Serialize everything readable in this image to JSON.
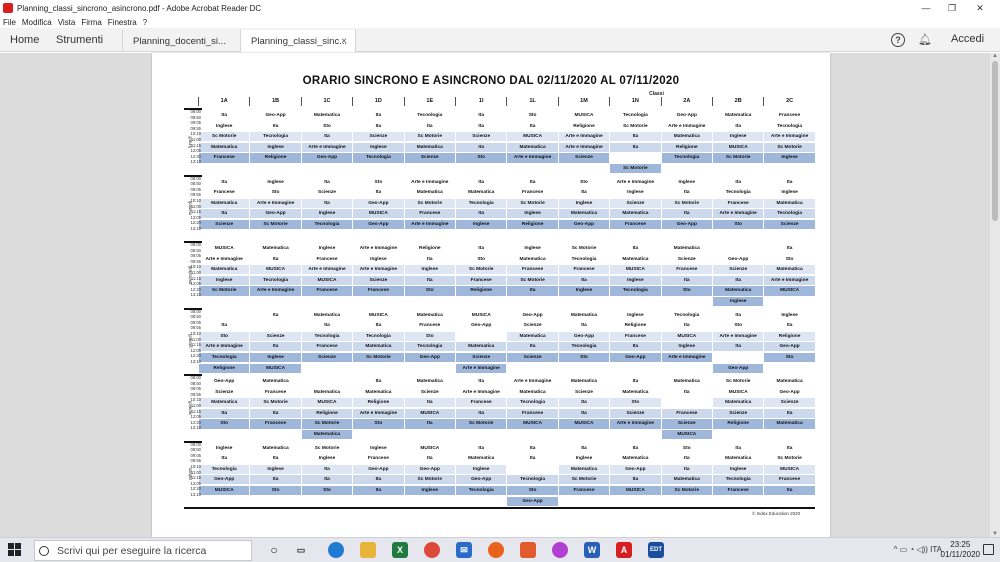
{
  "window": {
    "title": "Planning_classi_sincrono_asincrono.pdf - Adobe Acrobat Reader DC",
    "min": "—",
    "max": "❐",
    "close": "✕"
  },
  "menu": [
    "File",
    "Modifica",
    "Vista",
    "Firma",
    "Finestra",
    "?"
  ],
  "tabs": {
    "home": "Home",
    "tools": "Strumenti",
    "docs": [
      {
        "label": "Planning_docenti_si..."
      },
      {
        "label": "Planning_classi_sinc...",
        "close": "×"
      }
    ],
    "help": "?",
    "signin": "Accedi"
  },
  "doc": {
    "title": "ORARIO SINCRONO E ASINCRONO DAL 02/11/2020 AL 07/11/2020",
    "group_label": "Classi",
    "footer": "© Index Education 2020",
    "classes": [
      "1A",
      "1B",
      "1C",
      "1D",
      "1E",
      "1I",
      "1L",
      "1M",
      "1N",
      "2A",
      "2B",
      "2C"
    ],
    "colors": {
      "c0": "#ffffff",
      "c1": "#dfe6f3",
      "c2": "#ccd8ec",
      "c3": "#9fb7db"
    },
    "days": [
      {
        "name": "lunedì",
        "times": [
          "08:00",
          "08:50",
          "09:05",
          "09:55",
          "10:10",
          "11:00",
          "11:15",
          "12:05",
          "12:20",
          "13:10"
        ],
        "rows": [
          [
            "Ita",
            "Geo-App",
            "Matematica",
            "Ita",
            "Tecnologia",
            "Ita",
            "Sto",
            "MUSICA",
            "Tecnologia",
            "Geo-App",
            "Matematica",
            "Francese"
          ],
          [
            "Inglese",
            "Ita",
            "Sto",
            "Ita",
            "Ita",
            "Ita",
            "Ita",
            "Religione",
            "Sc Motorie",
            "Arte e Immagine",
            "Ita",
            "Tecnologia"
          ],
          [
            "Sc Motorie",
            "Tecnologia",
            "Ita",
            "Scienze",
            "Sc Motorie",
            "Scienze",
            "MUSICA",
            "Arte e Immagine",
            "Ita",
            "Matematica",
            "Inglese",
            "Arte e Immagine"
          ],
          [
            "Matematica",
            "Inglese",
            "Arte e Immagine",
            "Inglese",
            "Matematica",
            "Ita",
            "Matematica",
            "Arte e Immagine",
            "Ita",
            "Religione",
            "MUSICA",
            "Sc Motorie"
          ],
          [
            "Francese",
            "Religione",
            "Geo-App",
            "Tecnologia",
            "Scienze",
            "Sto",
            "Arte e Immagine",
            "Scienze",
            "",
            "Tecnologia",
            "Sc Motorie",
            "Inglese"
          ],
          [
            "",
            "",
            "",
            "",
            "",
            "",
            "",
            "",
            "Sc Motorie",
            "",
            "",
            ""
          ]
        ]
      },
      {
        "name": "martedì",
        "times": [
          "08:00",
          "08:50",
          "09:05",
          "09:55",
          "10:10",
          "11:00",
          "11:15",
          "12:05",
          "12:20",
          "13:10"
        ],
        "rows": [
          [
            "Ita",
            "Inglese",
            "Ita",
            "Sto",
            "Arte e Immagine",
            "Ita",
            "Ita",
            "Sto",
            "Arte e Immagine",
            "Inglese",
            "Ita",
            "Ita"
          ],
          [
            "Francese",
            "Sto",
            "Scienze",
            "Ita",
            "Matematica",
            "Matematica",
            "Francese",
            "Ita",
            "Inglese",
            "Ita",
            "Tecnologia",
            "Inglese"
          ],
          [
            "Matematica",
            "Arte e Immagine",
            "Ita",
            "Geo-App",
            "Sc Motorie",
            "Tecnologia",
            "Sc Motorie",
            "Inglese",
            "Scienze",
            "Sc Motorie",
            "Francese",
            "Matematica"
          ],
          [
            "Ita",
            "Geo-App",
            "Inglese",
            "MUSICA",
            "Francese",
            "Ita",
            "Inglese",
            "Matematica",
            "Matematica",
            "Ita",
            "Arte e Immagine",
            "Tecnologia"
          ],
          [
            "Scienze",
            "Sc Motorie",
            "Tecnologia",
            "Geo-App",
            "Arte e Immagine",
            "Inglese",
            "Religione",
            "Geo-App",
            "Francese",
            "Geo-App",
            "Sto",
            "Scienze"
          ],
          [
            "",
            "",
            "",
            "",
            "",
            "",
            "",
            "",
            "",
            "",
            "",
            ""
          ]
        ]
      },
      {
        "name": "mercoledì",
        "times": [
          "08:00",
          "08:50",
          "09:05",
          "09:55",
          "10:10",
          "11:00",
          "11:15",
          "12:05",
          "12:20",
          "13:10"
        ],
        "rows": [
          [
            "MUSICA",
            "Matematica",
            "Inglese",
            "Arte e Immagine",
            "Religione",
            "Ita",
            "Inglese",
            "Sc Motorie",
            "Ita",
            "Matematica",
            "",
            "Ita"
          ],
          [
            "Arte e Immagine",
            "Ita",
            "Francese",
            "Inglese",
            "Ita",
            "Sto",
            "Matematica",
            "Tecnologia",
            "Matematica",
            "Scienze",
            "Geo-App",
            "Sto"
          ],
          [
            "Matematica",
            "MUSICA",
            "Arte e Immagine",
            "Arte e Immagine",
            "Inglese",
            "Sc Motorie",
            "Francese",
            "Francese",
            "MUSICA",
            "Francese",
            "Scienze",
            "Matematica"
          ],
          [
            "Inglese",
            "Tecnologia",
            "MUSICA",
            "Scienze",
            "Ita",
            "Francese",
            "Sc Motorie",
            "Ita",
            "Inglese",
            "Ita",
            "Ita",
            "Arte e Immagine"
          ],
          [
            "Sc Motorie",
            "Arte e Immagine",
            "Francese",
            "Francese",
            "Sto",
            "Religione",
            "Ita",
            "Inglese",
            "Tecnologia",
            "Sto",
            "Matematica",
            "MUSICA"
          ],
          [
            "",
            "",
            "",
            "",
            "",
            "",
            "",
            "",
            "",
            "",
            "Inglese",
            ""
          ]
        ]
      },
      {
        "name": "giovedì",
        "times": [
          "08:00",
          "08:50",
          "09:05",
          "09:55",
          "10:10",
          "11:00",
          "11:15",
          "12:05",
          "12:20",
          "13:10"
        ],
        "rows": [
          [
            "",
            "Ita",
            "Matematica",
            "MUSICA",
            "Matematica",
            "MUSICA",
            "Geo-App",
            "Matematica",
            "Inglese",
            "Tecnologia",
            "Ita",
            "Inglese"
          ],
          [
            "Ita",
            "",
            "Ita",
            "Ita",
            "Francese",
            "Geo-App",
            "Scienze",
            "Ita",
            "Religione",
            "Ita",
            "Sto",
            "Ita"
          ],
          [
            "Sto",
            "Scienze",
            "Tecnologia",
            "Tecnologia",
            "Sto",
            "",
            "Matematica",
            "Geo-App",
            "Francese",
            "MUSICA",
            "Arte e Immagine",
            "Religione"
          ],
          [
            "Arte e Immagine",
            "Ita",
            "Francese",
            "Matematica",
            "Tecnologia",
            "Matematica",
            "Ita",
            "Tecnologia",
            "Ita",
            "Inglese",
            "Ita",
            "Geo-App"
          ],
          [
            "Tecnologia",
            "Inglese",
            "Scienze",
            "Sc Motorie",
            "Geo-App",
            "Scienze",
            "Scienze",
            "Sto",
            "Geo-App",
            "Arte e Immagine",
            "",
            "Sto"
          ],
          [
            "Religione",
            "MUSICA",
            "",
            "",
            "",
            "Arte e Immagine",
            "",
            "",
            "",
            "",
            "Geo-App",
            ""
          ]
        ]
      },
      {
        "name": "venerdì",
        "times": [
          "08:00",
          "08:50",
          "09:05",
          "09:55",
          "10:10",
          "11:00",
          "11:15",
          "12:05",
          "12:20",
          "13:10"
        ],
        "rows": [
          [
            "Geo-App",
            "Matematica",
            "",
            "Ita",
            "Matematica",
            "Ita",
            "Arte e Immagine",
            "Matematica",
            "Ita",
            "Matematica",
            "Sc Motorie",
            "Matematica"
          ],
          [
            "Scienze",
            "Francese",
            "Matematica",
            "Matematica",
            "Scienze",
            "Arte e Immagine",
            "Matematica",
            "Scienze",
            "Matematica",
            "Ita",
            "MUSICA",
            "Geo-App"
          ],
          [
            "Matematica",
            "Sc Motorie",
            "MUSICA",
            "Religione",
            "Ita",
            "Francese",
            "Tecnologia",
            "Ita",
            "Sto",
            "",
            "Matematica",
            "Scienze"
          ],
          [
            "Ita",
            "Ita",
            "Religione",
            "Arte e Immagine",
            "MUSICA",
            "Ita",
            "Francese",
            "Ita",
            "Scienze",
            "Francese",
            "Scienze",
            "Ita"
          ],
          [
            "Sto",
            "Francese",
            "Sc Motorie",
            "Sto",
            "Ita",
            "Sc Motorie",
            "MUSICA",
            "MUSICA",
            "Arte e Immagine",
            "Scienze",
            "Religione",
            "Matematica"
          ],
          [
            "",
            "",
            "Matematica",
            "",
            "",
            "",
            "",
            "",
            "",
            "MUSICA",
            "",
            ""
          ]
        ]
      },
      {
        "name": "sabato",
        "times": [
          "08:00",
          "08:50",
          "09:05",
          "09:55",
          "10:10",
          "11:00",
          "11:15",
          "12:05",
          "12:20",
          "13:10"
        ],
        "rows": [
          [
            "Inglese",
            "Matematica",
            "Sc Motorie",
            "Inglese",
            "MUSICA",
            "Ita",
            "Ita",
            "Ita",
            "Ita",
            "Sto",
            "Ita",
            "Ita"
          ],
          [
            "Ita",
            "Ita",
            "Inglese",
            "Francese",
            "Ita",
            "Matematica",
            "Ita",
            "Inglese",
            "Matematica",
            "Ita",
            "Matematica",
            "Sc Motorie"
          ],
          [
            "Tecnologia",
            "Inglese",
            "Ita",
            "Geo-App",
            "Geo-App",
            "Inglese",
            "",
            "Matematica",
            "Geo-App",
            "Ita",
            "Inglese",
            "MUSICA"
          ],
          [
            "Geo-App",
            "Ita",
            "Ita",
            "Ita",
            "Sc Motorie",
            "Geo-App",
            "Tecnologia",
            "Sc Motorie",
            "Ita",
            "Matematica",
            "Tecnologia",
            "Francese"
          ],
          [
            "MUSICA",
            "Sto",
            "Sto",
            "Ita",
            "Inglese",
            "Tecnologia",
            "Sto",
            "Francese",
            "MUSICA",
            "Sc Motorie",
            "Francese",
            "Ita"
          ],
          [
            "",
            "",
            "",
            "",
            "",
            "",
            "Geo-App",
            "",
            "",
            "",
            "",
            ""
          ]
        ]
      }
    ]
  },
  "taskbar": {
    "search_placeholder": "Scrivi qui per eseguire la ricerca",
    "lang": "ITA",
    "time": "23:25",
    "date": "01/11/2020"
  }
}
